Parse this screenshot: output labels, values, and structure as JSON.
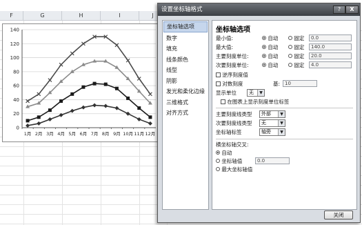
{
  "sheet": {
    "columns": [
      "F",
      "G",
      "H",
      "I",
      "J"
    ]
  },
  "chart_data": {
    "type": "line",
    "categories": [
      "1月",
      "2月",
      "3月",
      "4月",
      "5月",
      "6月",
      "7月",
      "8月",
      "9月",
      "10月",
      "11月",
      "12月"
    ],
    "series": [
      {
        "values": [
          38,
          48,
          68,
          90,
          106,
          120,
          130,
          130,
          118,
          96,
          70,
          48
        ],
        "color": "#4a4a4a",
        "marker": "x"
      },
      {
        "values": [
          30,
          35,
          50,
          66,
          80,
          90,
          95,
          95,
          86,
          70,
          52,
          35
        ],
        "color": "#8a8a8a",
        "marker": "triangle"
      },
      {
        "values": [
          10,
          15,
          25,
          38,
          48,
          58,
          63,
          62,
          56,
          42,
          28,
          15
        ],
        "color": "#1a1a1a",
        "marker": "square"
      },
      {
        "values": [
          3,
          6,
          12,
          18,
          24,
          29,
          32,
          31,
          28,
          20,
          12,
          6
        ],
        "color": "#333333",
        "marker": "diamond"
      }
    ],
    "ylim": [
      0,
      140
    ],
    "yticks": [
      "0",
      "20",
      "40",
      "60",
      "80",
      "100",
      "120",
      "140"
    ],
    "grid": true
  },
  "dialog": {
    "title": "设置坐标轴格式",
    "help_label": "?",
    "close_x": "X",
    "nav": [
      "坐标轴选项",
      "数字",
      "填充",
      "线条颜色",
      "线型",
      "阴影",
      "发光和柔化边缘",
      "三维格式",
      "对齐方式"
    ],
    "panel": {
      "heading": "坐标轴选项",
      "min_label": "最小值:",
      "max_label": "最大值:",
      "major_label": "主要刻度单位:",
      "minor_label": "次要刻度单位:",
      "auto_label": "自动",
      "fixed_label": "固定",
      "min_value": "0.0",
      "max_value": "140.0",
      "major_value": "20.0",
      "minor_value": "4.0",
      "reverse_label": "逆序刻度值",
      "log_label": "对数刻度",
      "log_base_label": "基:",
      "log_base_value": "10",
      "display_units_label": "显示单位",
      "display_units_value": "无",
      "show_units_label": "在图表上显示刻度单位标签",
      "major_mark_label": "主要刻度线类型",
      "major_mark_value": "外部",
      "minor_mark_label": "次要刻度线类型",
      "minor_mark_value": "无",
      "axis_labels_label": "坐标轴标签",
      "axis_labels_value": "轴旁",
      "cross_heading": "横坐标轴交叉:",
      "cross_auto": "自动",
      "cross_value_label": "坐标轴值",
      "cross_value": "0.0",
      "cross_max": "最大坐标轴值"
    },
    "close_button": "关闭"
  }
}
